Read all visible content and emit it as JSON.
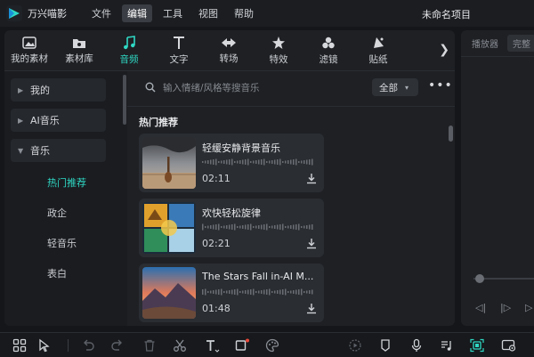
{
  "app": {
    "name": "万兴喵影",
    "project_title": "未命名项目"
  },
  "menu": [
    {
      "label": "文件",
      "active": false
    },
    {
      "label": "编辑",
      "active": true
    },
    {
      "label": "工具",
      "active": false
    },
    {
      "label": "视图",
      "active": false
    },
    {
      "label": "帮助",
      "active": false
    }
  ],
  "toolbar": {
    "tools": [
      {
        "label": "我的素材",
        "icon": "image-icon"
      },
      {
        "label": "素材库",
        "icon": "library-icon"
      },
      {
        "label": "音频",
        "icon": "music-note-icon",
        "active": true
      },
      {
        "label": "文字",
        "icon": "text-icon"
      },
      {
        "label": "转场",
        "icon": "transition-icon"
      },
      {
        "label": "特效",
        "icon": "effects-icon"
      },
      {
        "label": "滤镜",
        "icon": "filter-icon"
      },
      {
        "label": "贴纸",
        "icon": "sticker-icon"
      }
    ],
    "more_glyph": "❯"
  },
  "sidebar": {
    "categories": [
      {
        "label": "我的",
        "expanded": false
      },
      {
        "label": "AI音乐",
        "expanded": false
      },
      {
        "label": "音乐",
        "expanded": true
      }
    ],
    "subitems": [
      {
        "label": "热门推荐",
        "active": true
      },
      {
        "label": "政企",
        "active": false
      },
      {
        "label": "轻音乐",
        "active": false
      },
      {
        "label": "表白",
        "active": false
      }
    ],
    "collapse_glyph": "‹"
  },
  "search": {
    "placeholder": "输入情绪/风格等搜音乐",
    "filter_label": "全部",
    "more_glyph": "•••"
  },
  "section_title": "热门推荐",
  "tracks": [
    {
      "title": "轻缓安静背景音乐",
      "duration": "02:11"
    },
    {
      "title": "欢快轻松旋律",
      "duration": "02:21"
    },
    {
      "title": "The Stars Fall in-AI M...",
      "duration": "01:48"
    }
  ],
  "player": {
    "tabs": [
      {
        "label": "播放器",
        "active": false
      },
      {
        "label": "完整",
        "active": true
      }
    ]
  },
  "colors": {
    "accent": "#2fd8c4",
    "panel": "#1e2024",
    "background": "#14161a"
  }
}
